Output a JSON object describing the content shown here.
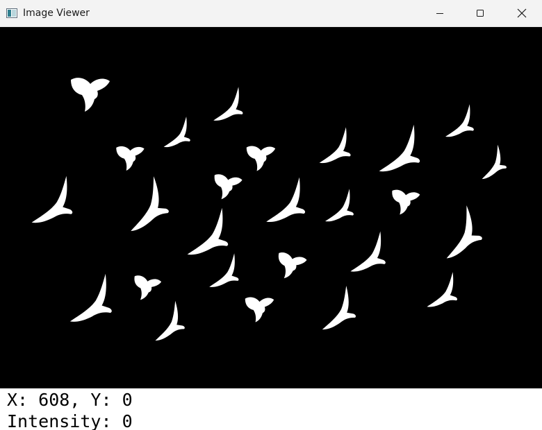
{
  "window": {
    "title": "Image Viewer",
    "app_icon": "image-viewer-app-icon",
    "controls": {
      "minimize_icon": "minimize-icon",
      "maximize_icon": "maximize-icon",
      "close_icon": "close-icon"
    }
  },
  "image": {
    "description_icon": "bird-silhouette",
    "background_color": "#000000",
    "foreground_color": "#ffffff"
  },
  "status": {
    "position_text": "X: 608, Y: 0",
    "intensity_text": "Intensity: 0"
  }
}
